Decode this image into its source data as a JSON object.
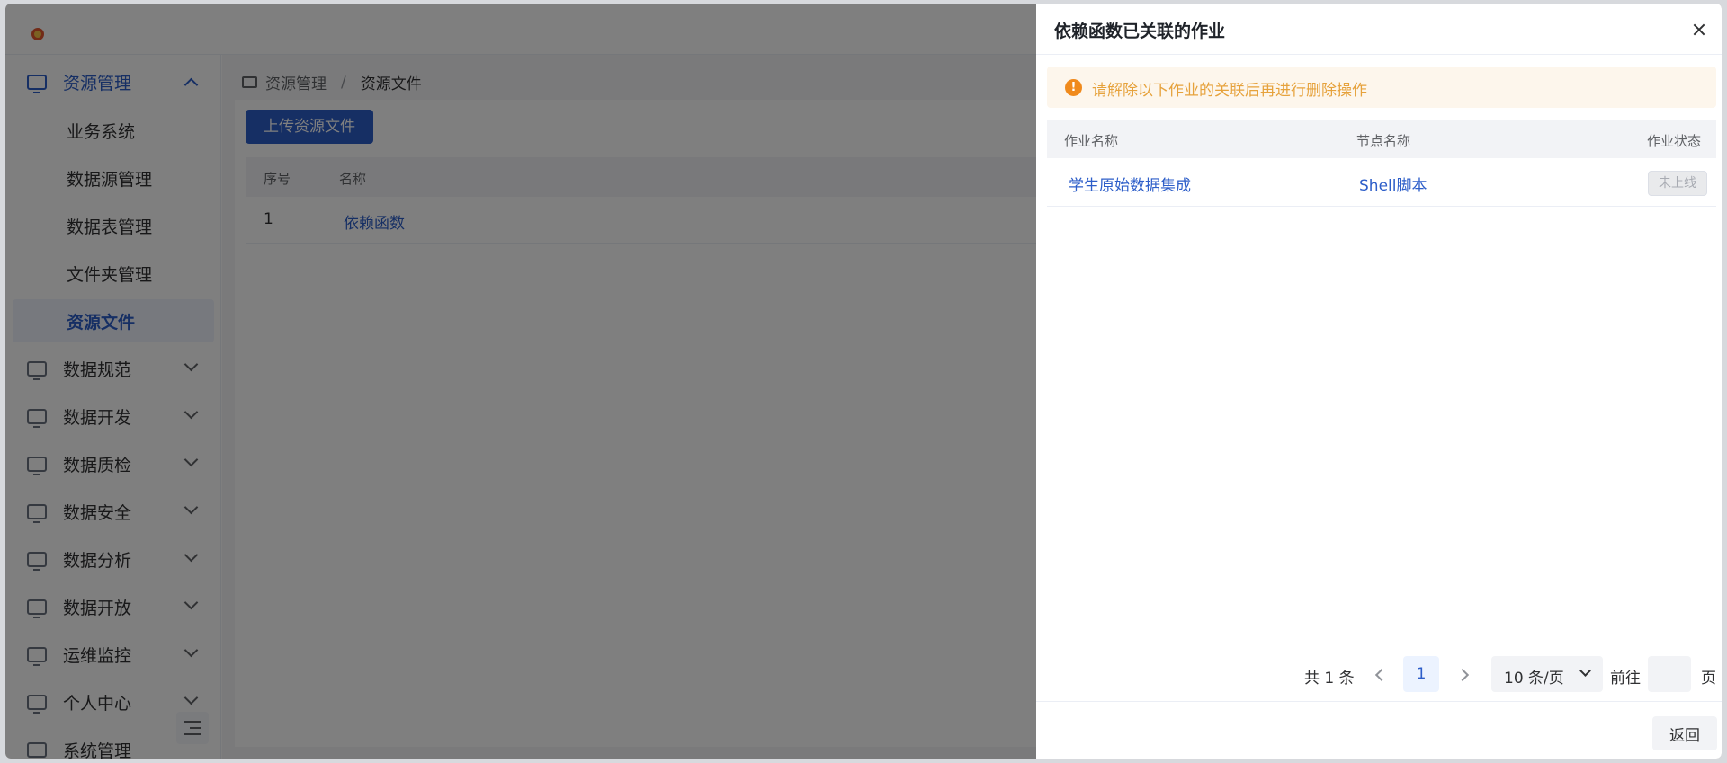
{
  "sidebar": {
    "groups": [
      {
        "label": "资源管理",
        "icon": "keyboard-icon",
        "open": true
      },
      {
        "label": "数据规范",
        "icon": "monitor-icon"
      },
      {
        "label": "数据开发",
        "icon": "code-icon"
      },
      {
        "label": "数据质检",
        "icon": "inspect-icon"
      },
      {
        "label": "数据安全",
        "icon": "shield-check-icon"
      },
      {
        "label": "数据分析",
        "icon": "chart-icon"
      },
      {
        "label": "数据开放",
        "icon": "share-icon"
      },
      {
        "label": "运维监控",
        "icon": "monitor-line-icon"
      },
      {
        "label": "个人中心",
        "icon": "user-icon"
      },
      {
        "label": "系统管理",
        "icon": "settings-icon"
      }
    ],
    "sub_items": [
      {
        "label": "业务系统"
      },
      {
        "label": "数据源管理"
      },
      {
        "label": "数据表管理"
      },
      {
        "label": "文件夹管理"
      },
      {
        "label": "资源文件",
        "active": true
      }
    ]
  },
  "breadcrumb": {
    "root": "资源管理",
    "separator": "/",
    "current": "资源文件"
  },
  "main": {
    "upload_label": "上传资源文件",
    "columns": {
      "index": "序号",
      "name": "名称"
    },
    "rows": [
      {
        "index": "1",
        "name": "依赖函数"
      }
    ]
  },
  "drawer": {
    "title": "依赖函数已关联的作业",
    "alert": "请解除以下作业的关联后再进行删除操作",
    "columns": {
      "job": "作业名称",
      "node": "节点名称",
      "status": "作业状态"
    },
    "rows": [
      {
        "job": "学生原始数据集成",
        "node": "Shell脚本",
        "status": "未上线"
      }
    ],
    "pagination": {
      "total": "共 1 条",
      "current_page": "1",
      "page_size": "10 条/页",
      "goto_label": "前往",
      "goto_value": "",
      "page_suffix": "页"
    },
    "back_label": "返回"
  },
  "colors": {
    "primary": "#2d5ec9",
    "warning": "#e6a23c",
    "overlay": "rgba(0,0,0,0.5)"
  }
}
